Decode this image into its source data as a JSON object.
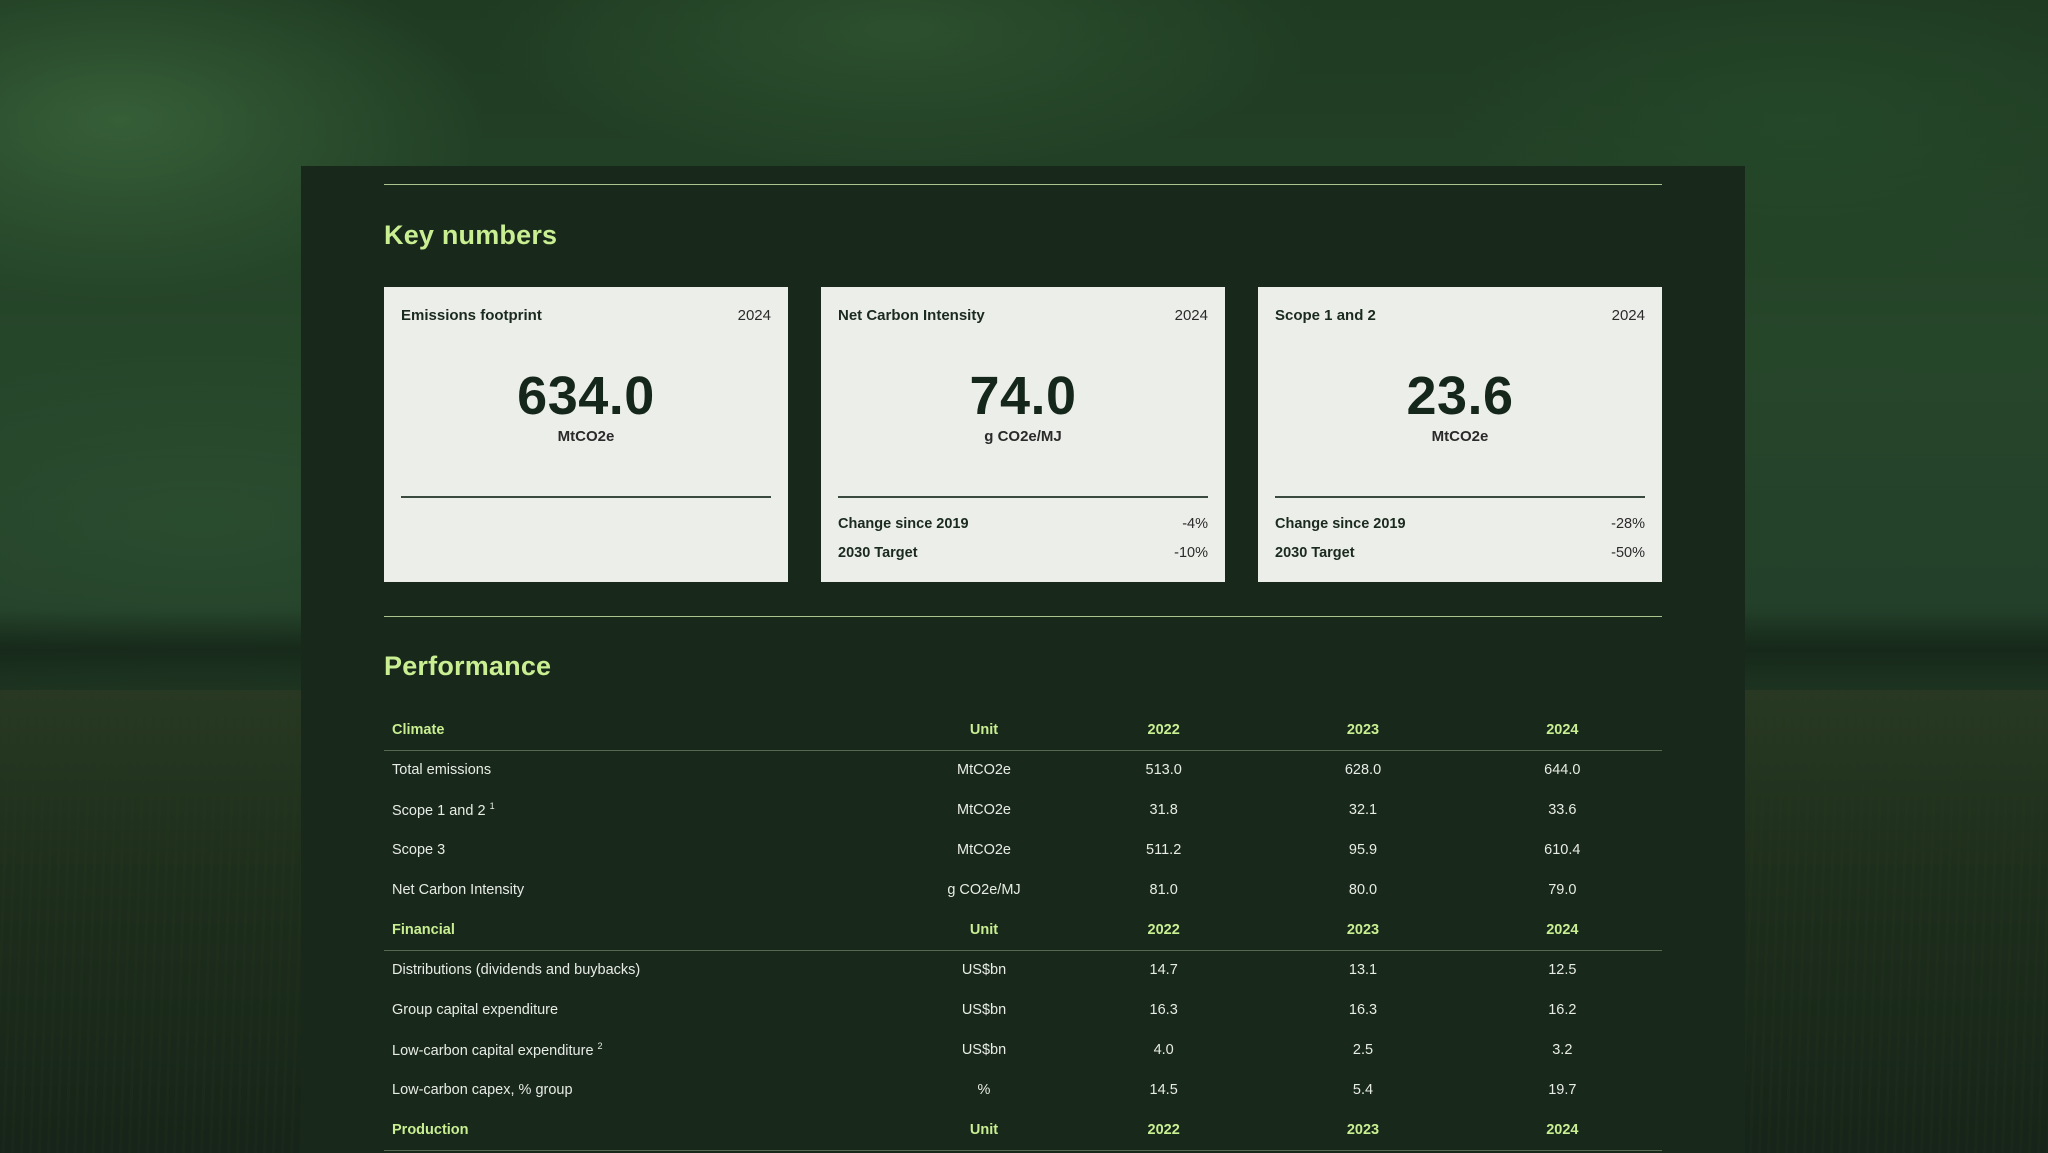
{
  "key_numbers": {
    "title": "Key numbers",
    "cards": [
      {
        "title": "Emissions footprint",
        "year": "2024",
        "value": "634.0",
        "unit": "MtCO2e",
        "rows": []
      },
      {
        "title": "Net Carbon Intensity",
        "year": "2024",
        "value": "74.0",
        "unit": "g CO2e/MJ",
        "rows": [
          {
            "label": "Change since 2019",
            "value": "-4%"
          },
          {
            "label": "2030 Target",
            "value": "-10%"
          }
        ]
      },
      {
        "title": "Scope 1 and 2",
        "year": "2024",
        "value": "23.6",
        "unit": "MtCO2e",
        "rows": [
          {
            "label": "Change since 2019",
            "value": "-28%"
          },
          {
            "label": "2030 Target",
            "value": "-50%"
          }
        ]
      }
    ]
  },
  "performance": {
    "title": "Performance",
    "sections": [
      {
        "header": [
          "Climate",
          "Unit",
          "2022",
          "2023",
          "2024"
        ],
        "rows": [
          {
            "label": "Total emissions",
            "sup": "",
            "unit": "MtCO2e",
            "values": [
              "513.0",
              "628.0",
              "644.0"
            ]
          },
          {
            "label": "Scope 1 and 2",
            "sup": "1",
            "unit": "MtCO2e",
            "values": [
              "31.8",
              "32.1",
              "33.6"
            ]
          },
          {
            "label": "Scope 3",
            "sup": "",
            "unit": "MtCO2e",
            "values": [
              "511.2",
              "95.9",
              "610.4"
            ]
          },
          {
            "label": "Net Carbon Intensity",
            "sup": "",
            "unit": "g CO2e/MJ",
            "values": [
              "81.0",
              "80.0",
              "79.0"
            ]
          }
        ]
      },
      {
        "header": [
          "Financial",
          "Unit",
          "2022",
          "2023",
          "2024"
        ],
        "rows": [
          {
            "label": "Distributions (dividends and buybacks)",
            "sup": "",
            "unit": "US$bn",
            "values": [
              "14.7",
              "13.1",
              "12.5"
            ]
          },
          {
            "label": "Group capital expenditure",
            "sup": "",
            "unit": "US$bn",
            "values": [
              "16.3",
              "16.3",
              "16.2"
            ]
          },
          {
            "label": "Low-carbon capital expenditure",
            "sup": "2",
            "unit": "US$bn",
            "values": [
              "4.0",
              "2.5",
              "3.2"
            ]
          },
          {
            "label": "Low-carbon capex, % group",
            "sup": "",
            "unit": "%",
            "values": [
              "14.5",
              "5.4",
              "19.7"
            ]
          }
        ]
      },
      {
        "header": [
          "Production",
          "Unit",
          "2022",
          "2023",
          "2024"
        ],
        "rows": []
      }
    ]
  }
}
